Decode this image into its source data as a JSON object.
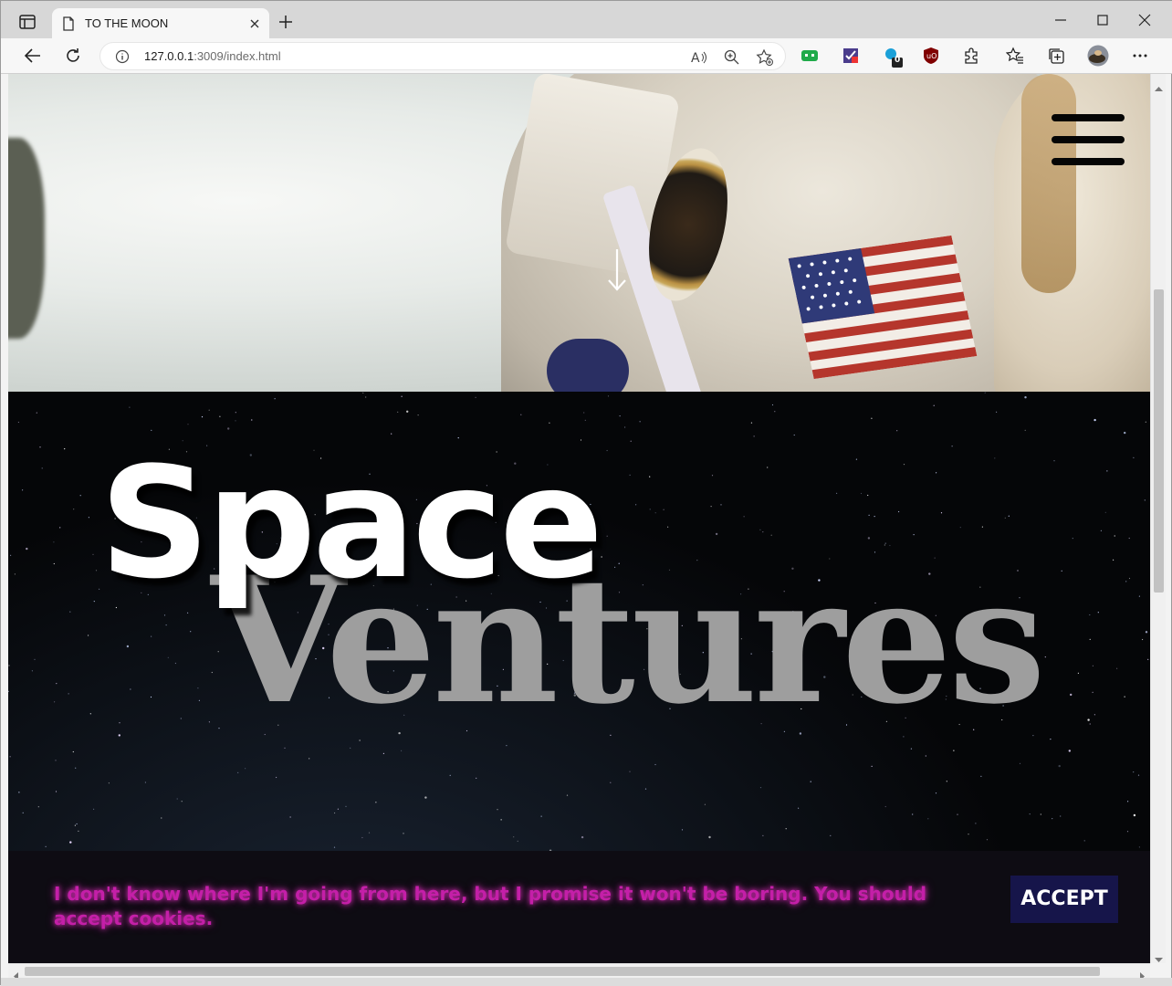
{
  "browser": {
    "tab_title": "TO THE MOON",
    "url_host": "127.0.0.1",
    "url_path": ":3009/index.html",
    "extension_badge": "0",
    "icons": [
      "tab-actions-icon",
      "page-icon",
      "close-icon",
      "new-tab-icon",
      "minimize-icon",
      "maximize-icon",
      "window-close-icon",
      "back-icon",
      "refresh-icon",
      "info-icon",
      "read-aloud-icon",
      "zoom-icon",
      "add-favorite-icon",
      "extension-icons",
      "favorites-icon",
      "collections-icon",
      "profile-avatar",
      "more-icon"
    ]
  },
  "page": {
    "hero": {
      "scroll_arrow": "↓"
    },
    "title_word_1": "Space",
    "title_word_2": "Ventures",
    "cookie": {
      "message": "I don't know where I'm going from here, but I promise it won't be boring. You should accept cookies.",
      "accept_label": "ACCEPT"
    },
    "colors": {
      "cookie_text": "#c41fa8",
      "accept_bg": "#16154a",
      "cookie_bar_bg": "#0e0c13",
      "ventures_text": "#9e9e9e"
    }
  }
}
